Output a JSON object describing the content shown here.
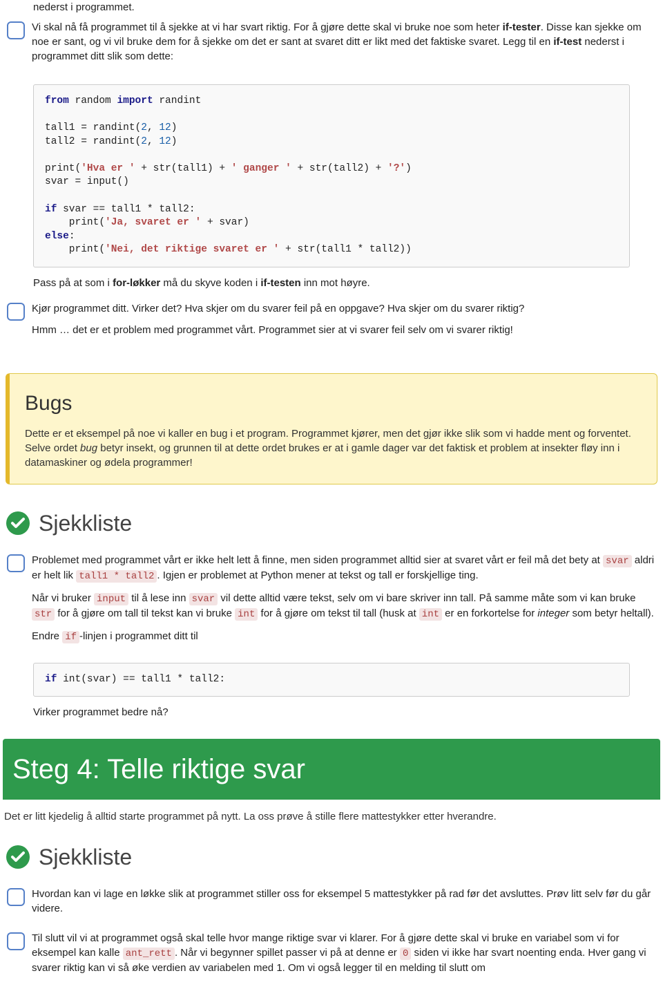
{
  "frag_top": "nederst i programmet.",
  "i1": {
    "p1a": "Vi skal nå få programmet til å sjekke at vi har svart riktig. For å gjøre dette skal vi bruke noe som heter ",
    "p1b": "if-tester",
    "p1c": ". Disse kan sjekke om noe er sant, og vi vil bruke dem for å sjekke om det er sant at svaret ditt er likt med det faktiske svaret. Legg til en ",
    "p1d": "if-test",
    "p1e": " nederst i programmet ditt slik som dette:"
  },
  "code1": "<span class=\"kw\">from</span> random <span class=\"kw\">import</span> randint\n\ntall1 = randint(<span class=\"num\">2</span>, <span class=\"num\">12</span>)\ntall2 = randint(<span class=\"num\">2</span>, <span class=\"num\">12</span>)\n\nprint(<span class=\"str\">'Hva er '</span> + str(tall1) + <span class=\"str\">' ganger '</span> + str(tall2) + <span class=\"str\">'?'</span>)\nsvar = input()\n\n<span class=\"kw\">if</span> svar == tall1 * tall2:\n    print(<span class=\"str\">'Ja, svaret er '</span> + svar)\n<span class=\"kw\">else</span>:\n    print(<span class=\"str\">'Nei, det riktige svaret er '</span> + str(tall1 * tall2))",
  "note1_a": "Pass på at som i ",
  "note1_b": "for-løkker",
  "note1_c": " må du skyve koden i ",
  "note1_d": "if-testen",
  "note1_e": " inn mot høyre.",
  "i2": {
    "p1": "Kjør programmet ditt. Virker det? Hva skjer om du svarer feil på en oppgave? Hva skjer om du svarer riktig?",
    "p2": "Hmm … det er et problem med programmet vårt. Programmet sier at vi svarer feil selv om vi svarer riktig!"
  },
  "bugs": {
    "title": "Bugs",
    "t1": "Dette er et eksempel på noe vi kaller en bug i et program. Programmet kjører, men det gjør ikke slik som vi hadde ment og forventet. Selve ordet ",
    "em": "bug",
    "t2": " betyr insekt, og grunnen til at dette ordet brukes er at i gamle dager var det faktisk et problem at insekter fløy inn i datamaskiner og ødela programmer!"
  },
  "sjekk": "Sjekkliste",
  "i3": {
    "p1a": "Problemet med programmet vårt er ikke helt lett å finne, men siden programmet alltid sier at svaret vårt er feil må det bety at ",
    "c1": "svar",
    "p1b": " aldri er helt lik ",
    "c2": "tall1 * tall2",
    "p1c": ". Igjen er problemet at Python mener at tekst og tall er forskjellige ting.",
    "p2a": "Når vi bruker ",
    "c3": "input",
    "p2b": " til å lese inn ",
    "c4": "svar",
    "p2c": " vil dette alltid være tekst, selv om vi bare skriver inn tall. På samme måte som vi kan bruke ",
    "c5": "str",
    "p2d": " for å gjøre om tall til tekst kan vi bruke ",
    "c6": "int",
    "p2e": " for å gjøre om tekst til tall (husk at ",
    "c7": "int",
    "p2f": " er en forkortelse for ",
    "em": "integer",
    "p2g": " som betyr heltall).",
    "p3a": "Endre ",
    "c8": "if",
    "p3b": "-linjen i programmet ditt til"
  },
  "code2": "<span class=\"kw\">if</span> int(svar) == tall1 * tall2:",
  "note2": "Virker programmet bedre nå?",
  "step4": {
    "title": "Steg 4: Telle riktige svar",
    "sub": "Det er litt kjedelig å alltid starte programmet på nytt. La oss prøve å stille flere mattestykker etter hverandre."
  },
  "i4": "Hvordan kan vi lage en løkke slik at programmet stiller oss for eksempel 5 mattestykker på rad før det avsluttes. Prøv litt selv før du går videre.",
  "i5": {
    "t1": "Til slutt vil vi at programmet også skal telle hvor mange riktige svar vi klarer. For å gjøre dette skal vi bruke en variabel som vi for eksempel kan kalle ",
    "c1": "ant_rett",
    "t2": ". Når vi begynner spillet passer vi på at denne er ",
    "c2": "0",
    "t3": " siden vi ikke har svart noenting enda. Hver gang vi svarer riktig kan vi så øke verdien av variabelen med 1. Om vi også legger til en melding til slutt om"
  }
}
